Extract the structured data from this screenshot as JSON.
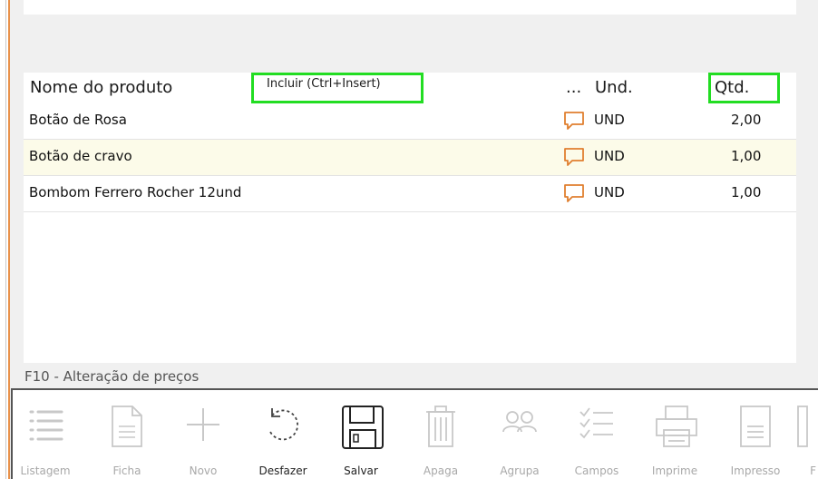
{
  "grid": {
    "headers": {
      "name": "Nome do produto",
      "more": "...",
      "unit": "Und.",
      "qty": "Qtd."
    },
    "tooltip": "Incluir (Ctrl+Insert)",
    "rows": [
      {
        "name": "Botão de Rosa",
        "unit": "UND",
        "qty": "2,00"
      },
      {
        "name": "Botão de cravo",
        "unit": "UND",
        "qty": "1,00"
      },
      {
        "name": "Bombom Ferrero Rocher 12und",
        "unit": "UND",
        "qty": "1,00"
      }
    ]
  },
  "status": {
    "text": "F10 - Alteração de preços"
  },
  "toolbar": {
    "buttons": [
      {
        "label": "Listagem",
        "icon": "list-icon",
        "enabled": false
      },
      {
        "label": "Ficha",
        "icon": "document-icon",
        "enabled": false
      },
      {
        "label": "Novo",
        "icon": "plus-icon",
        "enabled": false
      },
      {
        "label": "Desfazer",
        "icon": "undo-icon",
        "enabled": true
      },
      {
        "label": "Salvar",
        "icon": "floppy-disk-icon",
        "enabled": true
      },
      {
        "label": "Apaga",
        "icon": "trash-icon",
        "enabled": false
      },
      {
        "label": "Agrupa",
        "icon": "group-icon",
        "enabled": false
      },
      {
        "label": "Campos",
        "icon": "checklist-icon",
        "enabled": false
      },
      {
        "label": "Imprime",
        "icon": "printer-icon",
        "enabled": false
      },
      {
        "label": "Impresso",
        "icon": "printed-document-icon",
        "enabled": false
      },
      {
        "label": "F",
        "icon": "partial-icon",
        "enabled": false
      }
    ]
  },
  "colors": {
    "highlight": "#22dd22",
    "accent_stripe": "#e8914a",
    "comment_icon": "#e07f2f",
    "alt_row": "#fcfbe9"
  }
}
